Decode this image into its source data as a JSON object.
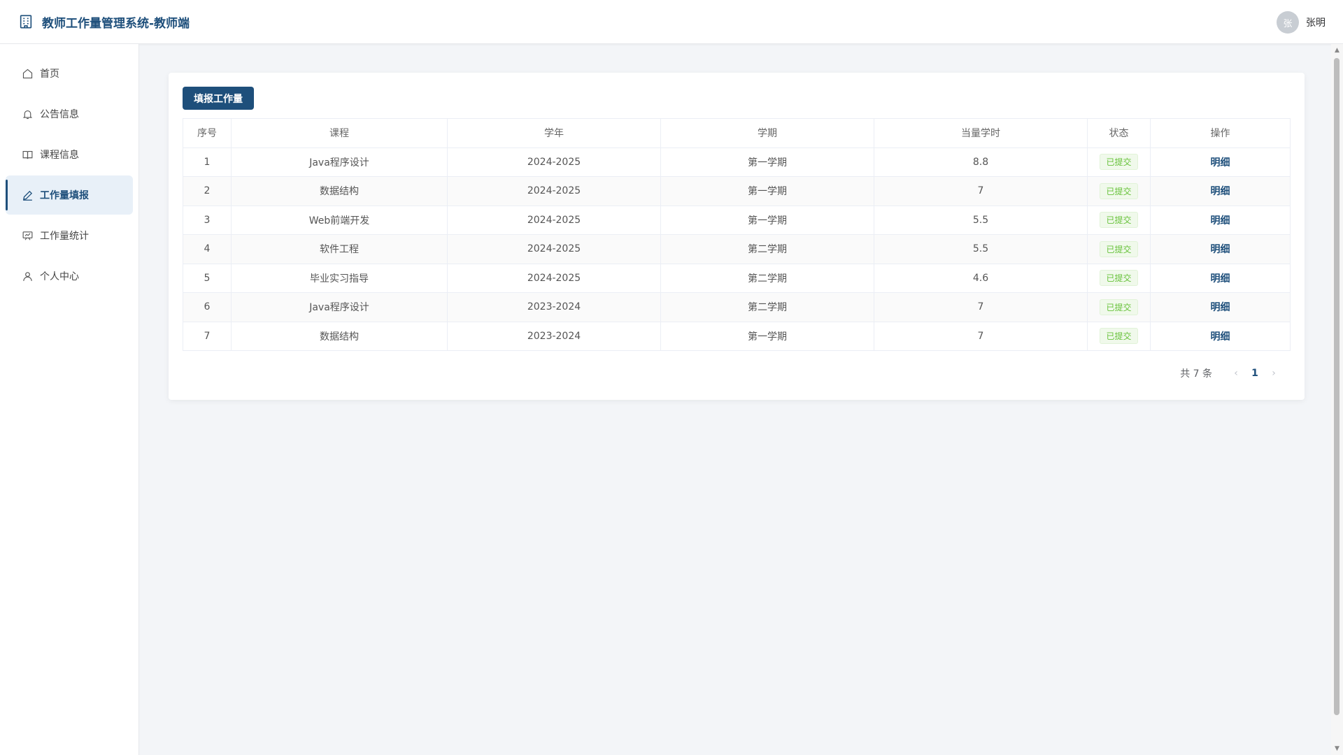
{
  "header": {
    "title": "教师工作量管理系统-教师端",
    "user": {
      "avatar_text": "张",
      "name": "张明"
    }
  },
  "sidebar": {
    "items": [
      {
        "label": "首页",
        "icon": "home-icon",
        "active": false
      },
      {
        "label": "公告信息",
        "icon": "bell-icon",
        "active": false
      },
      {
        "label": "课程信息",
        "icon": "book-icon",
        "active": false
      },
      {
        "label": "工作量填报",
        "icon": "edit-icon",
        "active": true
      },
      {
        "label": "工作量统计",
        "icon": "chart-board-icon",
        "active": false
      },
      {
        "label": "个人中心",
        "icon": "user-icon",
        "active": false
      }
    ]
  },
  "main": {
    "submit_button": "填报工作量",
    "table": {
      "columns": [
        "序号",
        "课程",
        "学年",
        "学期",
        "当量学时",
        "状态",
        "操作"
      ],
      "rows": [
        {
          "index": "1",
          "course": "Java程序设计",
          "year": "2024-2025",
          "term": "第一学期",
          "hours": "8.8",
          "status": "已提交",
          "action": "明细"
        },
        {
          "index": "2",
          "course": "数据结构",
          "year": "2024-2025",
          "term": "第一学期",
          "hours": "7",
          "status": "已提交",
          "action": "明细"
        },
        {
          "index": "3",
          "course": "Web前端开发",
          "year": "2024-2025",
          "term": "第一学期",
          "hours": "5.5",
          "status": "已提交",
          "action": "明细"
        },
        {
          "index": "4",
          "course": "软件工程",
          "year": "2024-2025",
          "term": "第二学期",
          "hours": "5.5",
          "status": "已提交",
          "action": "明细"
        },
        {
          "index": "5",
          "course": "毕业实习指导",
          "year": "2024-2025",
          "term": "第二学期",
          "hours": "4.6",
          "status": "已提交",
          "action": "明细"
        },
        {
          "index": "6",
          "course": "Java程序设计",
          "year": "2023-2024",
          "term": "第二学期",
          "hours": "7",
          "status": "已提交",
          "action": "明细"
        },
        {
          "index": "7",
          "course": "数据结构",
          "year": "2023-2024",
          "term": "第一学期",
          "hours": "7",
          "status": "已提交",
          "action": "明细"
        }
      ]
    },
    "pagination": {
      "total_text": "共 7 条",
      "current_page": "1",
      "prev": "‹",
      "next": "›"
    }
  },
  "colors": {
    "primary": "#1e4f7b",
    "status_green": "#67c23a",
    "active_bg": "#e8f0f8"
  }
}
